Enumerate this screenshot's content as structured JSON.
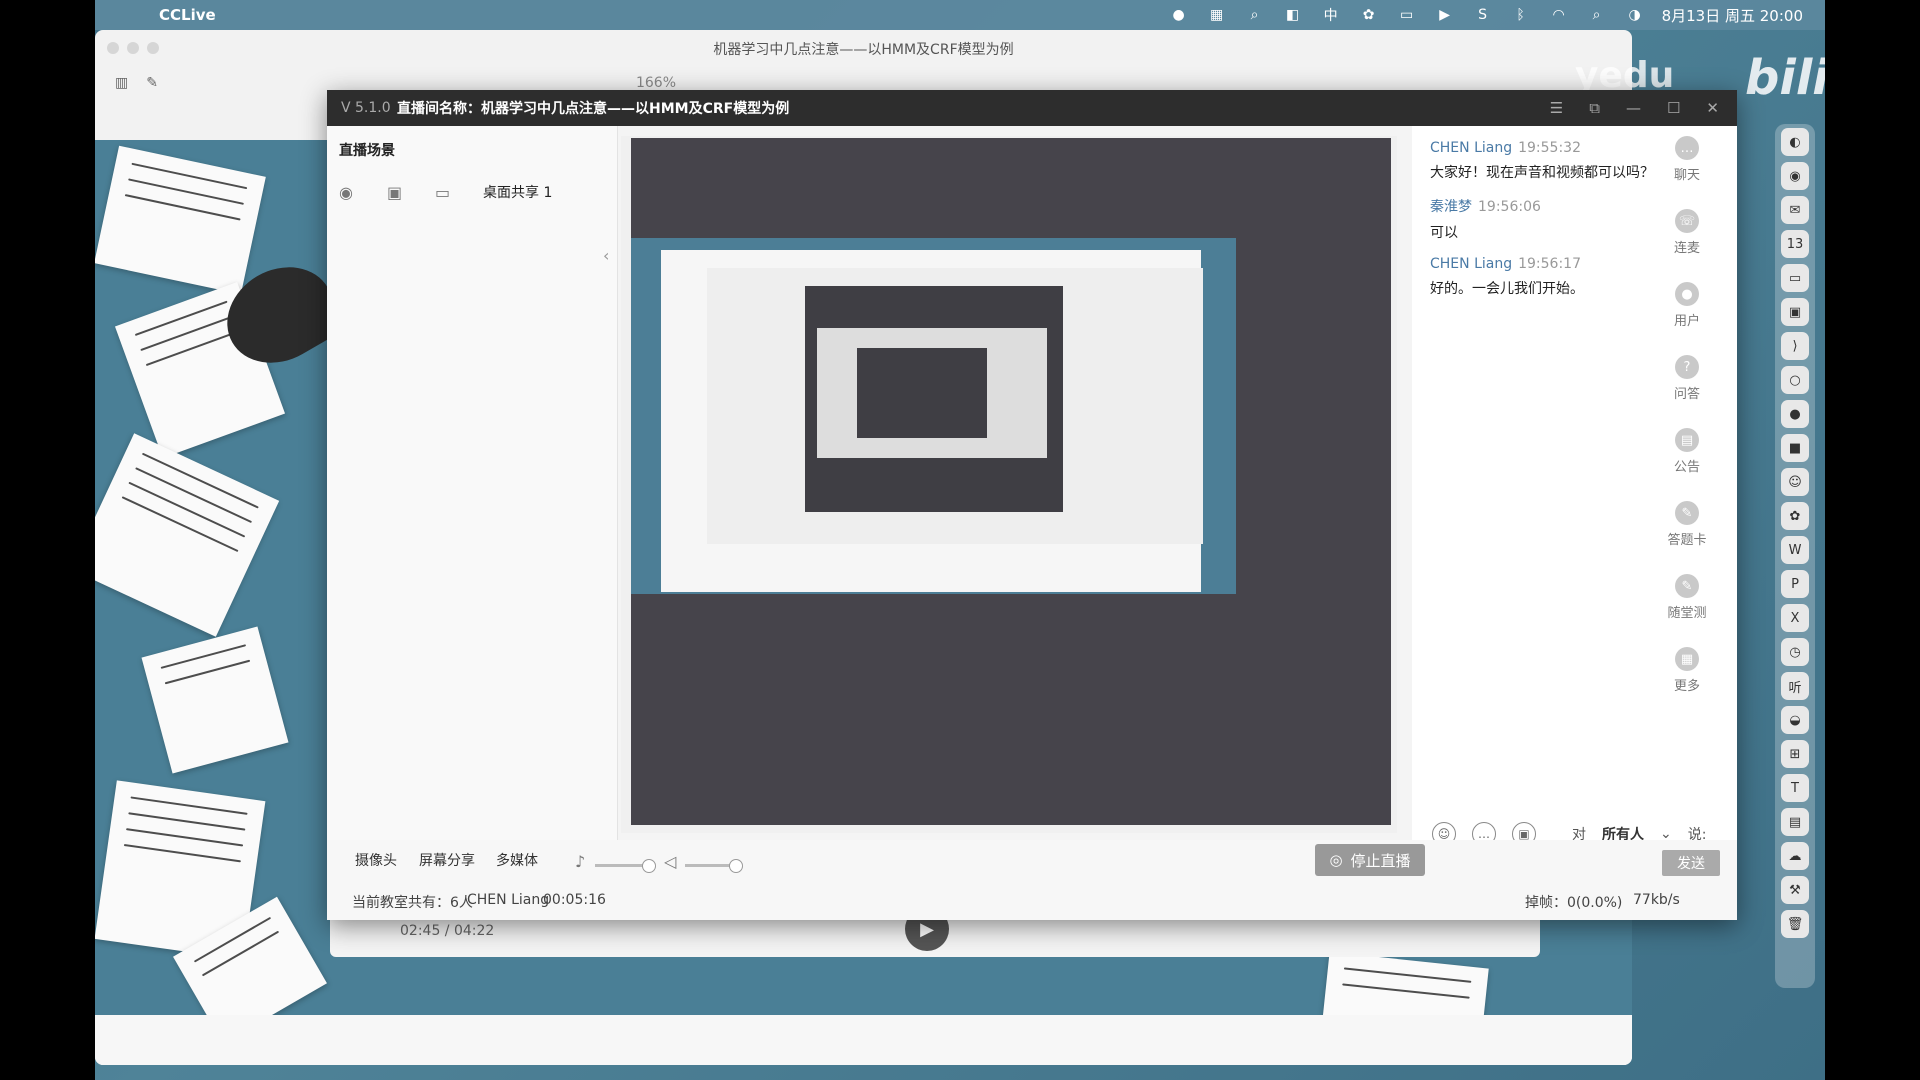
{
  "menubar": {
    "app_name": "CCLive",
    "datetime": "8月13日 周五 20:00",
    "tray_icons": [
      "qq-icon",
      "keyboard-icon",
      "search-icon",
      "notes-icon",
      "input-method-icon",
      "wechat-icon",
      "screen-icon",
      "play-icon",
      "sync-icon",
      "bluetooth-icon",
      "wifi-icon",
      "spotlight-icon",
      "control-center-icon"
    ],
    "input_method_label": "中"
  },
  "background_window": {
    "title": "机器学习中几点注意——以HMM及CRF模型为例",
    "zoom": "166%",
    "player_time": "02:45 / 04:22"
  },
  "watermark": {
    "source": "yedu",
    "brand": "bilibili"
  },
  "cclive": {
    "version": "V 5.1.0",
    "room_title": "直播间名称：机器学习中几点注意——以HMM及CRF模型为例",
    "scenes": {
      "title": "直播场景",
      "items": [
        {
          "label": "桌面共享 1"
        }
      ]
    },
    "controls": {
      "camera": "摄像头",
      "screen_share": "屏幕分享",
      "multimedia": "多媒体",
      "mic_level": 0.88,
      "speaker_level": 0.9,
      "stop_live": "停止直播",
      "send": "发送"
    },
    "status": {
      "room_count": "当前教室共有：6人",
      "user": "CHEN Liang",
      "elapsed": "00:05:16",
      "dropped": "掉帧：0(0.0%)",
      "bitrate": "77kb/s"
    },
    "chat": {
      "messages": [
        {
          "who": "CHEN Liang",
          "time": "19:55:32",
          "text": "大家好！现在声音和视频都可以吗？"
        },
        {
          "who": "秦淮梦",
          "time": "19:56:06",
          "text": "可以"
        },
        {
          "who": "CHEN Liang",
          "time": "19:56:17",
          "text": "好的。一会儿我们开始。"
        }
      ],
      "to_label": "对",
      "target": "所有人",
      "say_label": "说:",
      "side_tabs": [
        "聊天",
        "连麦",
        "用户",
        "问答",
        "公告",
        "答题卡",
        "随堂测",
        "更多"
      ]
    }
  }
}
